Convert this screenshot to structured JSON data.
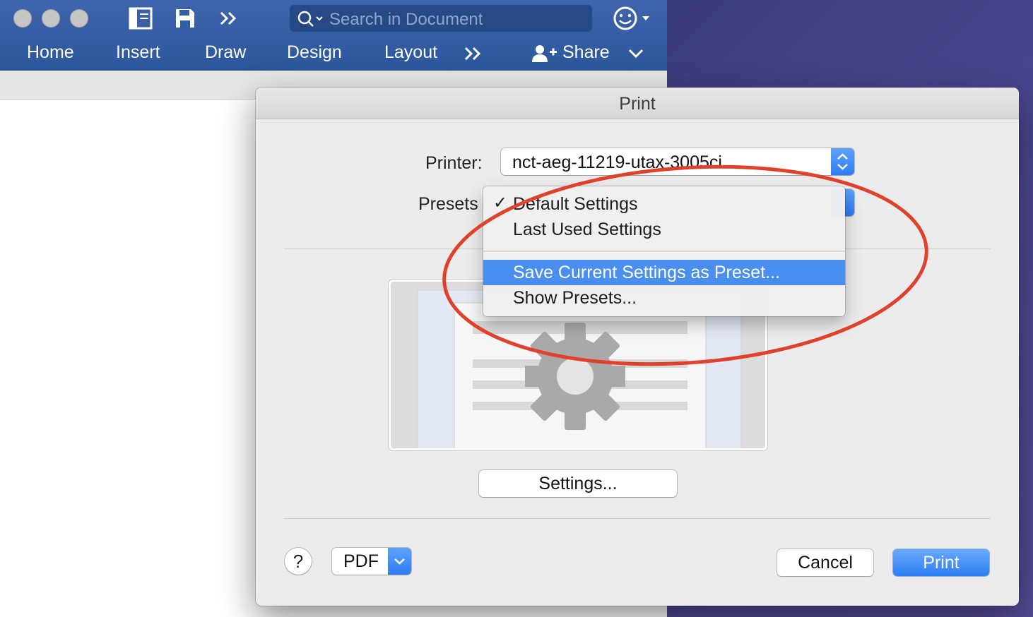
{
  "word": {
    "search_placeholder": "Search in Document",
    "tabs": [
      "Home",
      "Insert",
      "Draw",
      "Design",
      "Layout"
    ],
    "share_label": "Share"
  },
  "dialog": {
    "title": "Print",
    "printer_label": "Printer:",
    "printer_value": "nct-aeg-11219-utax-3005ci",
    "presets_label": "Presets",
    "settings_button": "Settings...",
    "help_label": "?",
    "pdf_label": "PDF",
    "cancel_label": "Cancel",
    "print_label": "Print"
  },
  "presets_menu": {
    "items": [
      {
        "label": "Default Settings",
        "checked": true
      },
      {
        "label": "Last Used Settings",
        "checked": false
      },
      {
        "label": "Save Current Settings as Preset...",
        "highlighted": true
      },
      {
        "label": "Show Presets...",
        "highlighted": false
      }
    ]
  },
  "colors": {
    "word_blue": "#2b579a",
    "accent_blue": "#2f7cf6",
    "menu_highlight": "#4a8ff0",
    "annotation_red": "#e0412c"
  }
}
